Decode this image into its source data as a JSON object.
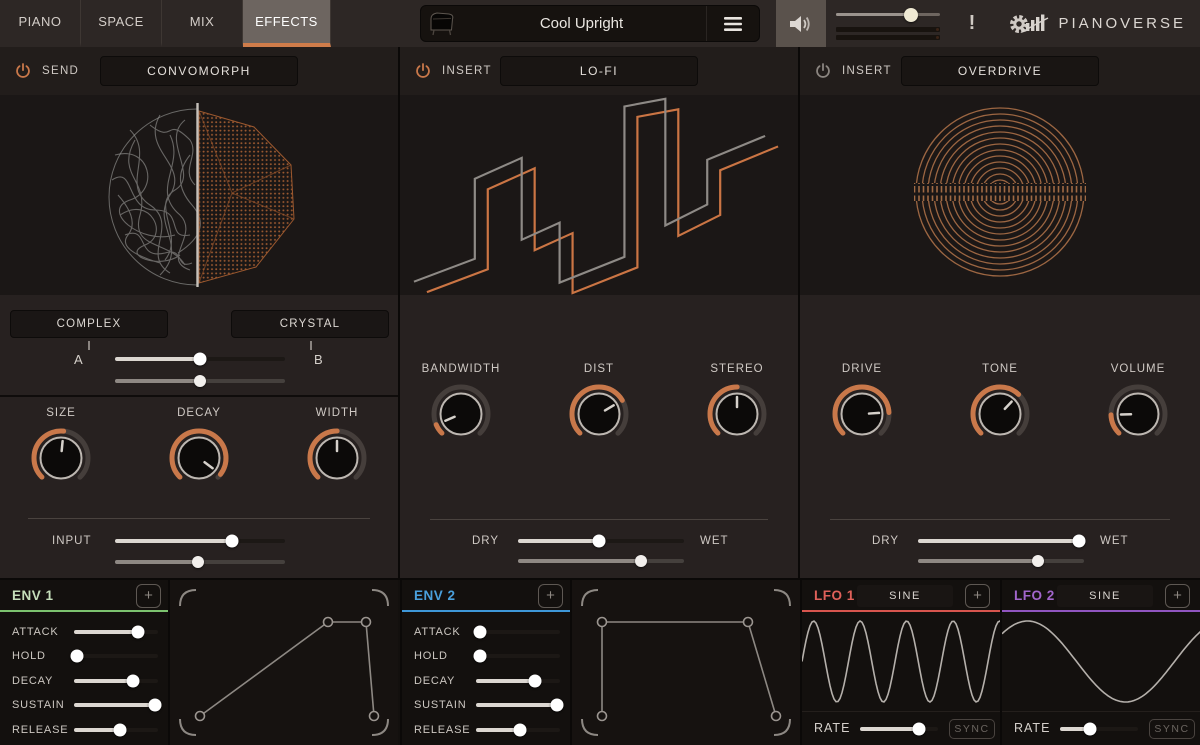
{
  "topbar": {
    "tabs": [
      {
        "label": "PIANO",
        "active": false
      },
      {
        "label": "SPACE",
        "active": false
      },
      {
        "label": "MIX",
        "active": false
      },
      {
        "label": "EFFECTS",
        "active": true
      }
    ],
    "accent": "#cf7c4a",
    "preset_name": "Cool Upright",
    "volume": 72,
    "alert_label": "!",
    "logo_text": "PIANOVERSE"
  },
  "convomorph": {
    "power_label": "SEND",
    "power_color": "#c9784a",
    "title": "CONVOMORPH",
    "button_a": "COMPLEX",
    "button_b": "CRYSTAL",
    "label_a": "A",
    "label_b": "B",
    "morph": 50,
    "morph_mod": 50,
    "knobs": [
      {
        "label": "SIZE",
        "value": 52
      },
      {
        "label": "DECAY",
        "value": 97
      },
      {
        "label": "WIDTH",
        "value": 50
      }
    ],
    "input_label": "INPUT",
    "input": 69,
    "input_mod": 49
  },
  "lofi": {
    "power_label": "INSERT",
    "power_color": "#c9784a",
    "title": "LO-FI",
    "knobs": [
      {
        "label": "BANDWIDTH",
        "value": 8
      },
      {
        "label": "DIST",
        "value": 72
      },
      {
        "label": "STEREO",
        "value": 50
      }
    ],
    "dry_label": "DRY",
    "wet_label": "WET",
    "mix": 49,
    "mix_mod": 74
  },
  "overdrive": {
    "power_label": "INSERT",
    "power_color": "#8b8580",
    "title": "OVERDRIVE",
    "knobs": [
      {
        "label": "DRIVE",
        "value": 82
      },
      {
        "label": "TONE",
        "value": 66
      },
      {
        "label": "VOLUME",
        "value": 16
      }
    ],
    "dry_label": "DRY",
    "wet_label": "WET",
    "mix": 97,
    "mix_mod": 72
  },
  "env1": {
    "title": "ENV 1",
    "title_color": "#c6dfbb",
    "accent": "#7cc36f",
    "add_label": "+",
    "sliders": [
      {
        "label": "ATTACK",
        "value": 76
      },
      {
        "label": "HOLD",
        "value": 4
      },
      {
        "label": "DECAY",
        "value": 70
      },
      {
        "label": "SUSTAIN",
        "value": 97
      },
      {
        "label": "RELEASE",
        "value": 55
      }
    ]
  },
  "env2": {
    "title": "ENV 2",
    "title_color": "#4aa0dc",
    "accent": "#3e97d8",
    "add_label": "+",
    "sliders": [
      {
        "label": "ATTACK",
        "value": 5
      },
      {
        "label": "HOLD",
        "value": 5
      },
      {
        "label": "DECAY",
        "value": 70
      },
      {
        "label": "SUSTAIN",
        "value": 97
      },
      {
        "label": "RELEASE",
        "value": 52
      }
    ]
  },
  "lfo1": {
    "title": "LFO 1",
    "title_color": "#e0615a",
    "accent": "#d8554e",
    "shape": "SINE",
    "add_label": "+",
    "rate_label": "RATE",
    "rate": 75,
    "sync_label": "SYNC",
    "wave": {
      "cycles": 4.3,
      "phase": 0
    }
  },
  "lfo2": {
    "title": "LFO 2",
    "title_color": "#a266cc",
    "accent": "#9055c0",
    "shape": "SINE",
    "add_label": "+",
    "rate_label": "RATE",
    "rate": 38,
    "sync_label": "SYNC",
    "wave": {
      "cycles": 1.02,
      "phase": 0.12
    }
  }
}
